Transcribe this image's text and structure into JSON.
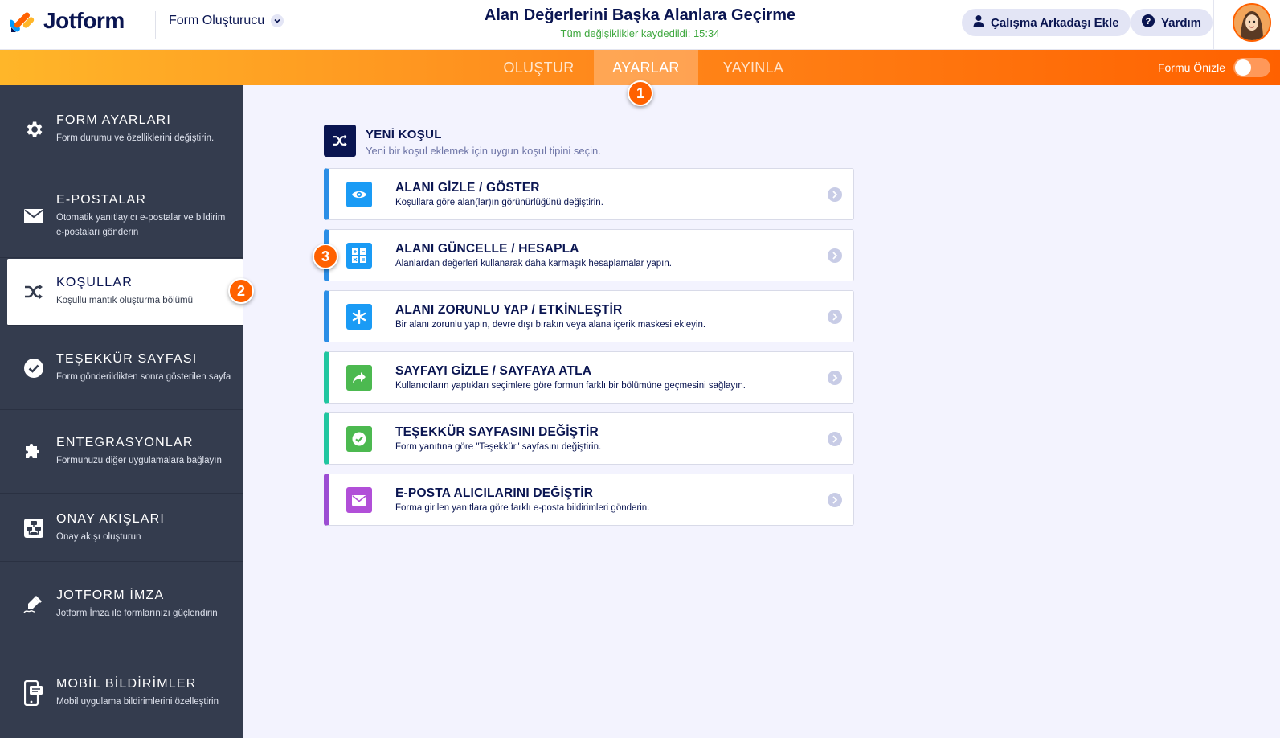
{
  "header": {
    "brand": "Jotform",
    "form_builder_label": "Form Oluşturucu",
    "title": "Alan Değerlerini Başka Alanlara Geçirme",
    "saved_status": "Tüm değişiklikler kaydedildi: 15:34",
    "add_collaborator_label": "Çalışma Arkadaşı Ekle",
    "help_label": "Yardım"
  },
  "nav": {
    "tabs": [
      {
        "label": "OLUŞTUR",
        "active": false
      },
      {
        "label": "AYARLAR",
        "active": true
      },
      {
        "label": "YAYINLA",
        "active": false
      }
    ],
    "preview_label": "Formu Önizle",
    "preview_enabled": false
  },
  "badges": [
    "1",
    "2",
    "3"
  ],
  "sidebar": {
    "items": [
      {
        "title": "FORM AYARLARI",
        "desc": "Form durumu ve özelliklerini değiştirin.",
        "icon": "gear-icon",
        "active": false
      },
      {
        "title": "E-POSTALAR",
        "desc": "Otomatik yanıtlayıcı e-postalar ve bildirim e-postaları gönderin",
        "icon": "envelope-icon",
        "active": false
      },
      {
        "title": "KOŞULLAR",
        "desc": "Koşullu mantık oluşturma bölümü",
        "icon": "shuffle-icon",
        "active": true
      },
      {
        "title": "TEŞEKKÜR SAYFASI",
        "desc": "Form gönderildikten sonra gösterilen sayfa",
        "icon": "check-circle-icon",
        "active": false
      },
      {
        "title": "ENTEGRASYONLAR",
        "desc": "Formunuzu diğer uygulamalara bağlayın",
        "icon": "puzzle-icon",
        "active": false
      },
      {
        "title": "ONAY AKIŞLARI",
        "desc": "Onay akışı oluşturun",
        "icon": "flow-icon",
        "active": false
      },
      {
        "title": "JOTFORM İMZA",
        "desc": "Jotform İmza ile formlarınızı güçlendirin",
        "icon": "signature-pen-icon",
        "active": false
      },
      {
        "title": "MOBİL BİLDİRİMLER",
        "desc": "Mobil uygulama bildirimlerini özelleştirin",
        "icon": "mobile-icon",
        "active": false
      }
    ]
  },
  "main": {
    "new_condition_title": "YENİ KOŞUL",
    "new_condition_subtitle": "Yeni bir koşul eklemek için uygun koşul tipini seçin.",
    "cards": [
      {
        "title": "ALANI GİZLE / GÖSTER",
        "desc": "Koşullara göre alan(lar)ın görünürlüğünü değiştirin.",
        "icon": "eye-icon",
        "color": "#2b8ee6"
      },
      {
        "title": "ALANI GÜNCELLE / HESAPLA",
        "desc": "Alanlardan değerleri kullanarak daha karmaşık hesaplamalar yapın.",
        "icon": "calculator-icon",
        "color": "#2b8ee6"
      },
      {
        "title": "ALANI ZORUNLU YAP / ETKİNLEŞTİR",
        "desc": "Bir alanı zorunlu yapın, devre dışı bırakın veya alana içerik maskesi ekleyin.",
        "icon": "asterisk-icon",
        "color": "#2b8ee6"
      },
      {
        "title": "SAYFAYI GİZLE / SAYFAYA ATLA",
        "desc": "Kullanıcıların yaptıkları seçimlere göre formun farklı bir bölümüne geçmesini sağlayın.",
        "icon": "share-arrow-icon",
        "color": "#20c6a0"
      },
      {
        "title": "TEŞEKKÜR SAYFASINI DEĞİŞTİR",
        "desc": "Form yanıtına göre \"Teşekkür\" sayfasını değiştirin.",
        "icon": "check-icon",
        "color": "#20c6a0"
      },
      {
        "title": "E-POSTA ALICILARINI DEĞİŞTİR",
        "desc": "Forma girilen yanıtlara göre farklı e-posta bildirimleri gönderin.",
        "icon": "envelope-icon",
        "color": "#9c4dd3"
      }
    ]
  },
  "colors": {
    "accent": "#ff6100",
    "sidebar_bg": "#343c4e",
    "navy": "#0a1551",
    "blue": "#2b8ee6",
    "green": "#20c6a0",
    "purple": "#9c4dd3"
  }
}
